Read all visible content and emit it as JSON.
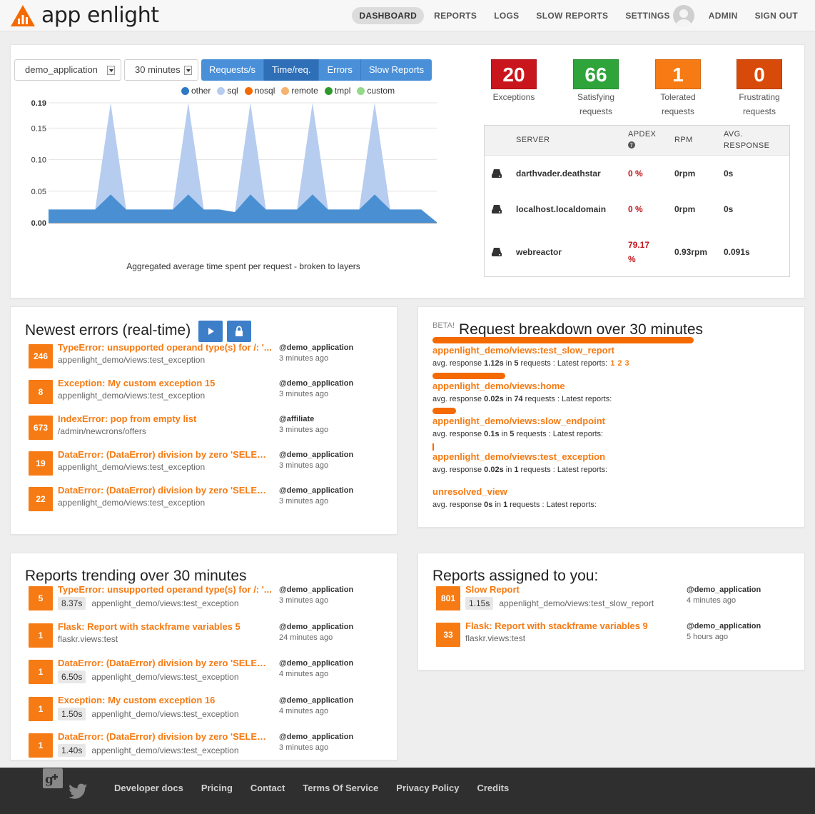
{
  "app": {
    "name": "app enlight"
  },
  "nav": [
    {
      "label": "DASHBOARD",
      "active": true
    },
    {
      "label": "REPORTS"
    },
    {
      "label": "LOGS"
    },
    {
      "label": "SLOW REPORTS"
    },
    {
      "label": "SETTINGS"
    },
    {
      "label": "ADMIN"
    },
    {
      "label": "SIGN OUT"
    }
  ],
  "filters": {
    "application": "demo_application",
    "period": "30 minutes"
  },
  "metric_tabs": [
    {
      "label": "Requests/s"
    },
    {
      "label": "Time/req.",
      "active": true
    },
    {
      "label": "Errors"
    },
    {
      "label": "Slow Reports"
    }
  ],
  "chart_data": {
    "type": "area",
    "title": "",
    "xlabel": "",
    "ylabel": "",
    "ylim": [
      0,
      0.19
    ],
    "yticks": [
      "0.00",
      "0.05",
      "0.10",
      "0.15",
      "0.19"
    ],
    "caption": "Aggregated average time spent per request - broken to layers",
    "series": [
      {
        "name": "other",
        "color": "#4a8fd2",
        "values": [
          0.021,
          0.021,
          0.021,
          0.021,
          0.045,
          0.021,
          0.021,
          0.021,
          0.021,
          0.045,
          0.021,
          0.021,
          0.017,
          0.045,
          0.021,
          0.021,
          0.021,
          0.045,
          0.021,
          0.021,
          0.021,
          0.045,
          0.021,
          0.021,
          0.021,
          0.001
        ]
      },
      {
        "name": "sql",
        "color": "#b7cdef",
        "values": [
          0,
          0,
          0,
          0,
          0.145,
          0,
          0,
          0,
          0,
          0.145,
          0,
          0,
          0,
          0.145,
          0,
          0,
          0,
          0.145,
          0,
          0,
          0,
          0.145,
          0,
          0,
          0,
          0
        ]
      },
      {
        "name": "nosql",
        "color": "#f56a00",
        "values": []
      },
      {
        "name": "remote",
        "color": "#f7b26f",
        "values": []
      },
      {
        "name": "tmpl",
        "color": "#2e9a2e",
        "values": []
      },
      {
        "name": "custom",
        "color": "#92d98a",
        "values": []
      }
    ]
  },
  "apdex": [
    {
      "value": "20",
      "label1": "Exceptions",
      "label2": "",
      "color": "#c9161d"
    },
    {
      "value": "66",
      "label1": "Satisfying",
      "label2": "requests",
      "color": "#2fa43a"
    },
    {
      "value": "1",
      "label1": "Tolerated",
      "label2": "requests",
      "color": "#f67b14"
    },
    {
      "value": "0",
      "label1": "Frustrating",
      "label2": "requests",
      "color": "#d84a0a"
    }
  ],
  "servers": {
    "headers": {
      "server": "SERVER",
      "apdex": "APDEX",
      "rpm": "RPM",
      "avg1": "AVG.",
      "avg2": "RESPONSE"
    },
    "rows": [
      {
        "name": "darthvader.deathstar",
        "apdex": "0 %",
        "rpm": "0rpm",
        "avg": "0s"
      },
      {
        "name": "localhost.localdomain",
        "apdex": "0 %",
        "rpm": "0rpm",
        "avg": "0s"
      },
      {
        "name": "webreactor",
        "apdex1": "79.17",
        "apdex2": "%",
        "rpm": "0.93rpm",
        "avg": "0.091s"
      }
    ]
  },
  "newest_errors": {
    "title": "Newest errors (real-time)",
    "items": [
      {
        "count": "246",
        "title": "TypeError: unsupported operand type(s) for /: '...",
        "view": "appenlight_demo/views:test_exception",
        "app": "@demo_application",
        "time": "3 minutes ago"
      },
      {
        "count": "8",
        "title": "Exception: My custom exception 15",
        "view": "appenlight_demo/views:test_exception",
        "app": "@demo_application",
        "time": "3 minutes ago"
      },
      {
        "count": "673",
        "title": "IndexError: pop from empty list",
        "view": "/admin/newcrons/offers",
        "app": "@affiliate",
        "time": "3 minutes ago"
      },
      {
        "count": "19",
        "title": "DataError: (DataError) division by zero 'SELECT...",
        "view": "appenlight_demo/views:test_exception",
        "app": "@demo_application",
        "time": "3 minutes ago"
      },
      {
        "count": "22",
        "title": "DataError: (DataError) division by zero 'SELECT...",
        "view": "appenlight_demo/views:test_exception",
        "app": "@demo_application",
        "time": "3 minutes ago"
      }
    ]
  },
  "breakdown": {
    "beta": "BETA!",
    "title": "Request breakdown over 30 minutes",
    "items": [
      {
        "bar": 1.0,
        "view": "appenlight_demo/views:test_slow_report",
        "pre": "avg. response ",
        "avg": "1.12s",
        "mid1": " in ",
        "count": "5",
        "mid2": " requests : Latest reports:",
        "links": [
          "1",
          "2",
          "3"
        ]
      },
      {
        "bar": 0.28,
        "view": "appenlight_demo/views:home",
        "pre": "avg. response ",
        "avg": "0.02s",
        "mid1": " in ",
        "count": "74",
        "mid2": " requests : Latest reports:",
        "links": []
      },
      {
        "bar": 0.09,
        "view": "appenlight_demo/views:slow_endpoint",
        "pre": "avg. response ",
        "avg": "0.1s",
        "mid1": " in ",
        "count": "5",
        "mid2": " requests : Latest reports:",
        "links": []
      },
      {
        "bar": 0.005,
        "view": "appenlight_demo/views:test_exception",
        "pre": "avg. response ",
        "avg": "0.02s",
        "mid1": " in ",
        "count": "1",
        "mid2": " requests : Latest reports:",
        "links": []
      },
      {
        "bar": 0,
        "view": "unresolved_view",
        "pre": "avg. response ",
        "avg": "0s",
        "mid1": " in ",
        "count": "1",
        "mid2": " requests : Latest reports:",
        "links": []
      }
    ]
  },
  "trending": {
    "title": "Reports trending over 30 minutes",
    "items": [
      {
        "count": "5",
        "title": "TypeError: unsupported operand type(s) for /: '...",
        "duration": "8.37s",
        "view": "appenlight_demo/views:test_exception",
        "app": "@demo_application",
        "time": "3 minutes ago"
      },
      {
        "count": "1",
        "title": "Flask: Report with stackframe variables 5",
        "duration": "",
        "view": "flaskr.views:test",
        "app": "@demo_application",
        "time": "24 minutes ago"
      },
      {
        "count": "1",
        "title": "DataError: (DataError) division by zero 'SELECT...",
        "duration": "6.50s",
        "view": "appenlight_demo/views:test_exception",
        "app": "@demo_application",
        "time": "4 minutes ago"
      },
      {
        "count": "1",
        "title": "Exception: My custom exception 16",
        "duration": "1.50s",
        "view": "appenlight_demo/views:test_exception",
        "app": "@demo_application",
        "time": "4 minutes ago"
      },
      {
        "count": "1",
        "title": "DataError: (DataError) division by zero 'SELECT...",
        "duration": "1.40s",
        "view": "appenlight_demo/views:test_exception",
        "app": "@demo_application",
        "time": "3 minutes ago"
      }
    ]
  },
  "assigned": {
    "title": "Reports assigned to you:",
    "items": [
      {
        "count": "801",
        "title": "Slow Report",
        "duration": "1.15s",
        "view": "appenlight_demo/views:test_slow_report",
        "app": "@demo_application",
        "time": "4 minutes ago"
      },
      {
        "count": "33",
        "title": "Flask: Report with stackframe variables 9",
        "duration": "",
        "view": "flaskr.views:test",
        "app": "@demo_application",
        "time": "5 hours ago"
      }
    ]
  },
  "footer": {
    "links": [
      "Developer docs",
      "Pricing",
      "Contact",
      "Terms Of Service",
      "Privacy Policy",
      "Credits"
    ],
    "social": [
      "google-plus-icon",
      "twitter-icon"
    ]
  },
  "colors": {
    "accent": "#f67b14",
    "primary_button": "#4a90d9",
    "footer_bg": "#2f2f2f"
  }
}
